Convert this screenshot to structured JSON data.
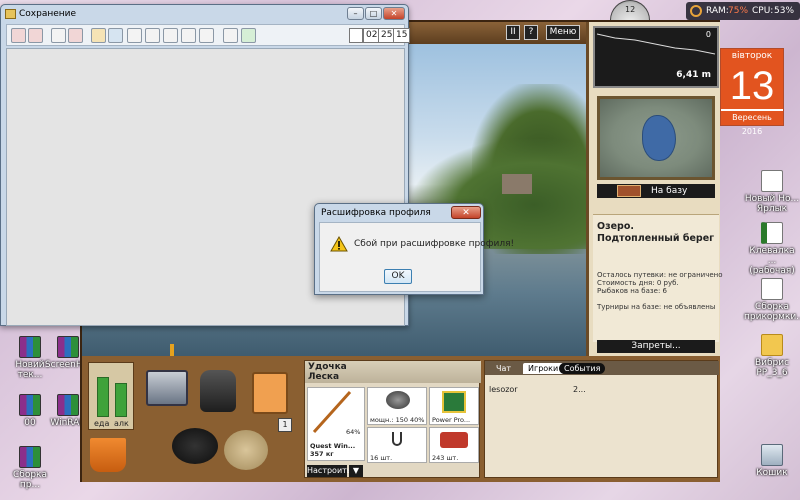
{
  "desktop_icons": [
    {
      "label": "Новий тек...",
      "kind": "ico-rar"
    },
    {
      "label": "ScreenH...",
      "kind": "ico-rar"
    },
    {
      "label": "00",
      "kind": "ico-rar"
    },
    {
      "label": "WinRAR",
      "kind": "ico-rar"
    },
    {
      "label": "Сборка пр...",
      "kind": "ico-rar"
    },
    {
      "label": "Новый Но... Ярлык",
      "kind": "ico-doc"
    },
    {
      "label": "Клевалка ... (рабочая)",
      "kind": "ico-xls"
    },
    {
      "label": "Сборка прикормки...",
      "kind": "ico-doc"
    },
    {
      "label": "Вибрис РР_3_6",
      "kind": "ico-folder"
    },
    {
      "label": "Кошик",
      "kind": "ico-bin"
    }
  ],
  "system": {
    "ram_label": "RAM:",
    "ram_value": "75%",
    "cpu_label": "CPU:",
    "cpu_value": "53%"
  },
  "calendar": {
    "weekday": "вівторок",
    "day": "13",
    "month_year": "Вересень 2016"
  },
  "clock": {
    "hour_mark": "12"
  },
  "explorer": {
    "title": "Сохранение",
    "numbers": [
      "02",
      "25",
      "15"
    ]
  },
  "game": {
    "pause_label": "II",
    "help_label": "?",
    "menu_label": "Меню",
    "depth_value": "6,41 m",
    "depth_mark": "0",
    "to_base_label": "На базу",
    "place_title": "Озеро. Подтопленный берег",
    "place_info": [
      "Осталось путевки: не ограничено",
      "Стоимость дня: 0 руб.",
      "Рыбаков на базе: 6",
      "",
      "Турниры на базе: не объявлены"
    ],
    "bans_label": "Запреты...",
    "bars": {
      "food_label": "еда",
      "alco_label": "алк"
    },
    "one_badge": "1",
    "rod": {
      "header_line1": "Удочка",
      "header_line2": "Леска",
      "rod_percent": "64%",
      "rod_name": "Quest Win...",
      "rod_weight": "357 кг",
      "reel_text": "мощн.: 150",
      "reel_percent": "40%",
      "line_name": "Power Pro...",
      "hook_count": "16 шт.",
      "bait_count": "243 шт.",
      "setup_label": "Настроить",
      "arrow_label": "▼"
    },
    "chat": {
      "tabs": [
        "Чат",
        "Игроки",
        "События"
      ],
      "player_name": "lesozor",
      "player_value": "2..."
    }
  },
  "dialog": {
    "title": "Расшифровка профиля",
    "close_label": "✕",
    "message": "Сбой при расшифровке профиля!",
    "ok_label": "OK"
  }
}
